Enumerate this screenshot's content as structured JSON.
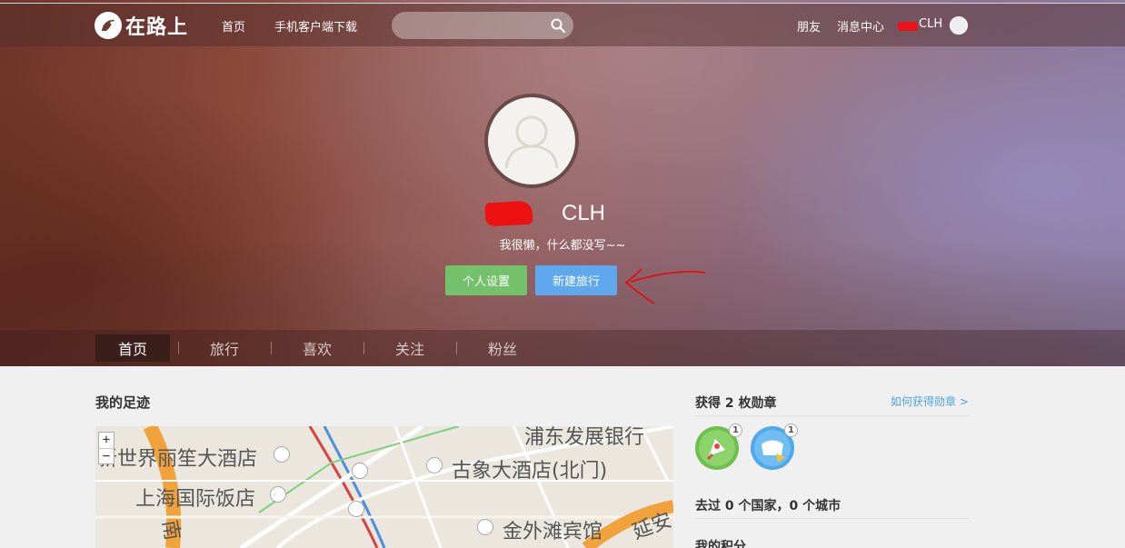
{
  "nav": {
    "logo_text": "在路上",
    "home": "首页",
    "app_download": "手机客户端下载",
    "search_placeholder": "",
    "friends": "朋友",
    "messages": "消息中心",
    "username": "CLH"
  },
  "profile": {
    "name": "CLH",
    "bio": "我很懒，什么都没写~~",
    "settings_button": "个人设置",
    "new_trip_button": "新建旅行"
  },
  "tabs": [
    "首页",
    "旅行",
    "喜欢",
    "关注",
    "粉丝"
  ],
  "footprints": {
    "title": "我的足迹",
    "zoom_in": "+",
    "zoom_out": "−",
    "map_labels": [
      "浦东发展银行",
      "新世界丽笙大酒店",
      "古象大酒店(北门)",
      "上海国际饭店",
      "金外滩宾馆",
      "延安",
      "南"
    ]
  },
  "badges": {
    "title": "获得 2 枚勋章",
    "link": "如何获得勋章 >",
    "items": [
      {
        "icon": "rocket-badge-icon",
        "count": "1",
        "color": "#6bbf4a"
      },
      {
        "icon": "bird-badge-icon",
        "count": "1",
        "color": "#4fa8e8"
      }
    ]
  },
  "visited": "去过 0 个国家，0 个城市",
  "points_title": "我的积分"
}
